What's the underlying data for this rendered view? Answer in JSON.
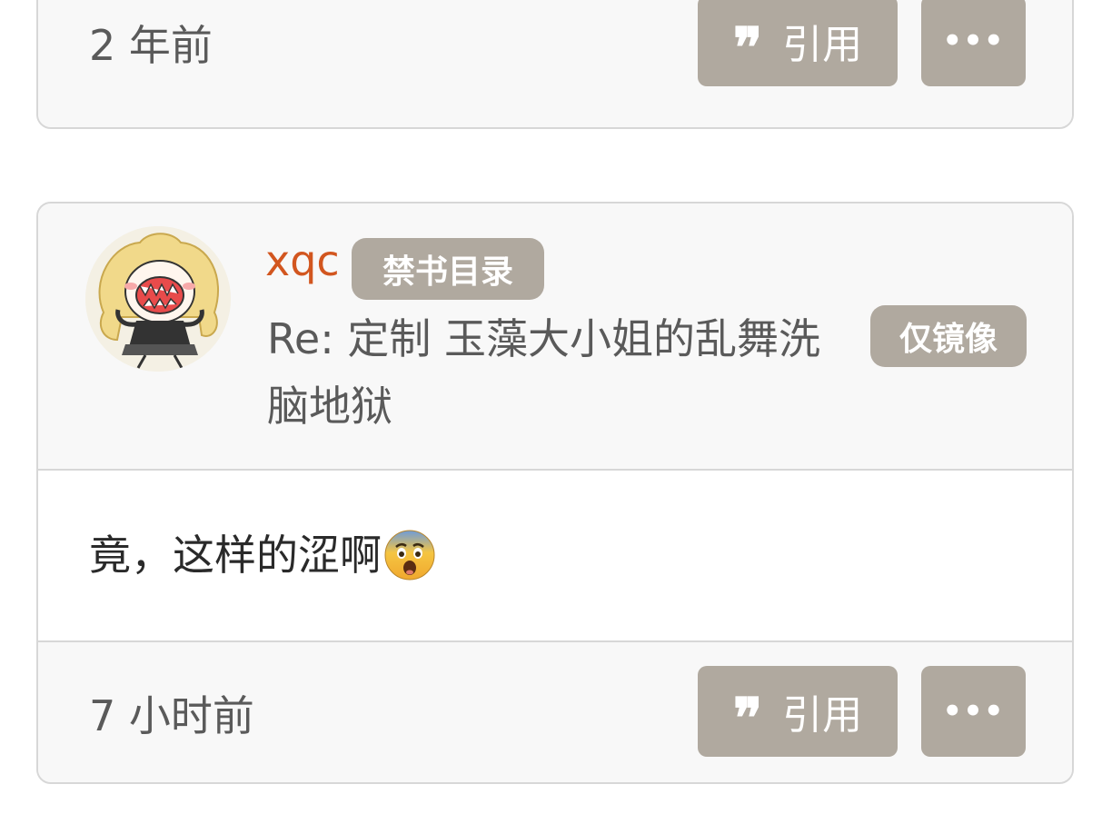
{
  "previous_post": {
    "time": "2 年前",
    "quote_label": "引用",
    "more_label": "•••"
  },
  "post": {
    "username": "xqc",
    "group_badge": "禁书目录",
    "subject": "Re: 定制 玉藻大小姐的乱舞洗脑地狱",
    "mirror_badge": "仅镜像",
    "content": "竟，这样的涩啊",
    "emoji": "anxious-face-with-sweat",
    "time": "7 小时前",
    "quote_label": "引用",
    "more_label": "•••"
  },
  "colors": {
    "username": "#d2561f",
    "badge_bg": "#b0a99f",
    "card_bg": "#f8f8f8",
    "border": "#d7d7d7"
  }
}
